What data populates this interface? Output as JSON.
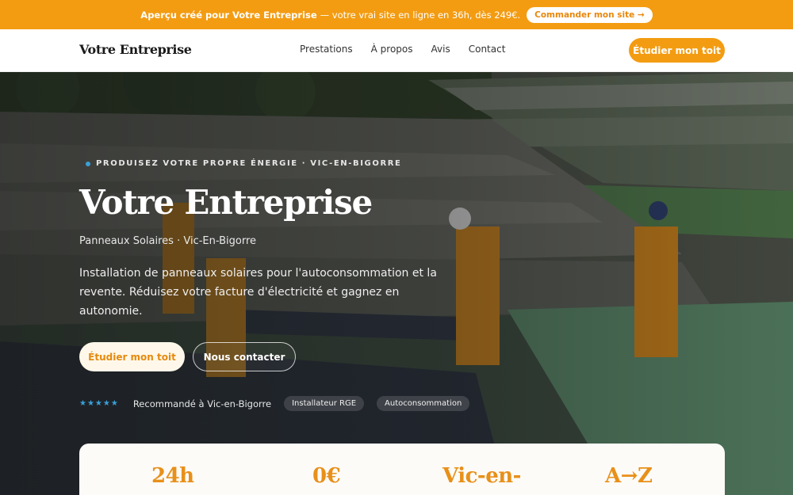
{
  "promo": {
    "strong": "Aperçu créé pour Votre Entreprise",
    "light": "— votre vrai site en ligne en 36h, dès 249€.",
    "cta": "Commander mon site →"
  },
  "nav": {
    "brand": "Votre Entreprise",
    "links": [
      "Prestations",
      "À propos",
      "Avis",
      "Contact"
    ],
    "cta": "Étudier mon toit"
  },
  "hero": {
    "eyebrow": "PRODUISEZ VOTRE PROPRE ÉNERGIE · VIC-EN-BIGORRE",
    "title": "Votre Entreprise",
    "subtitle": "Panneaux Solaires · Vic-En-Bigorre",
    "description": "Installation de panneaux solaires pour l'autoconsommation et la revente. Réduisez votre facture d'électricité et gagnez en autonomie.",
    "primary_button": "Étudier mon toit",
    "secondary_button": "Nous contacter",
    "stars": "★★★★★",
    "trust_text": "Recommandé à Vic-en-Bigorre",
    "badges": [
      "Installateur RGE",
      "Autoconsommation"
    ]
  },
  "stats": [
    "24h",
    "0€",
    "Vic-en-",
    "A→Z"
  ],
  "colors": {
    "accent": "#f39c12",
    "accent_text": "#e8901a",
    "star_blue": "#3aa0d8"
  }
}
